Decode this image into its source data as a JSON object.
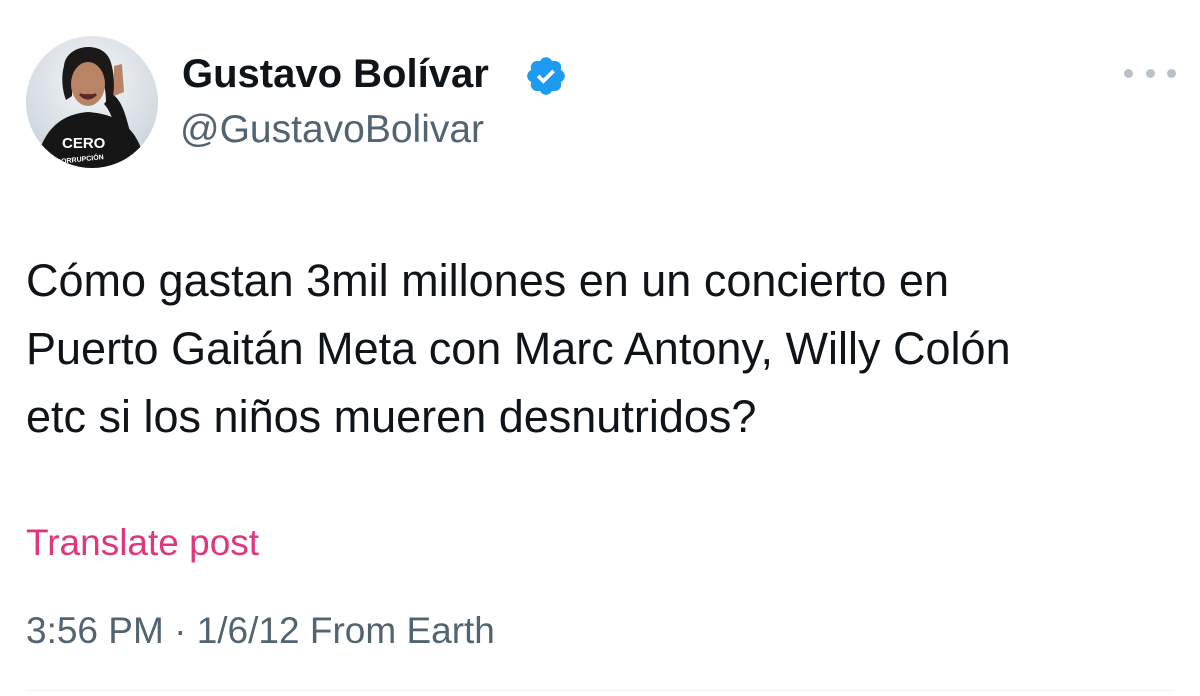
{
  "author": {
    "display_name": "Gustavo Bolívar",
    "handle": "@GustavoBolivar",
    "verified": true,
    "avatar_shirt_text_1": "CERO",
    "avatar_shirt_text_2": "CORRUPCIÓN"
  },
  "tweet": {
    "lines": [
      "Cómo gastan 3mil millones en un concierto en",
      "Puerto Gaitán Meta con Marc Antony, Willy Colón",
      "etc si los niños mueren desnutridos?"
    ],
    "translate_label": "Translate post"
  },
  "meta": {
    "time": "3:56 PM",
    "separator": "·",
    "date": "1/6/12",
    "source": "From Earth"
  },
  "icons": {
    "verified": "verified-badge-icon",
    "more": "more-options-icon"
  },
  "colors": {
    "verified": "#1d9bf0",
    "translate_link": "#e0367f",
    "secondary_text": "#536471",
    "primary_text": "#0f1419"
  }
}
